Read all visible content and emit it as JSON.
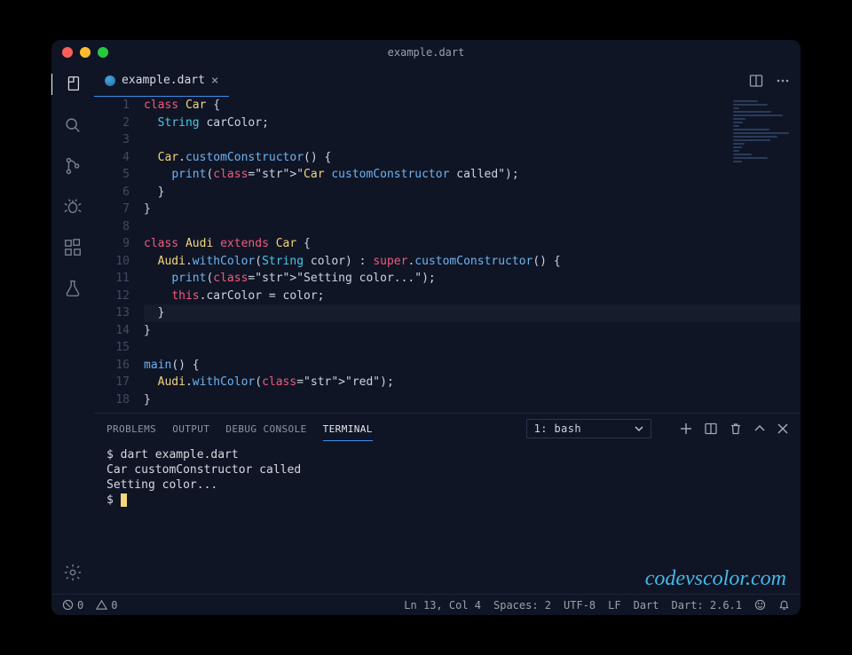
{
  "window": {
    "title": "example.dart"
  },
  "tab": {
    "filename": "example.dart"
  },
  "code": {
    "lines": [
      "class Car {",
      "  String carColor;",
      "",
      "  Car.customConstructor() {",
      "    print(\"Car customConstructor called\");",
      "  }",
      "}",
      "",
      "class Audi extends Car {",
      "  Audi.withColor(String color) : super.customConstructor() {",
      "    print(\"Setting color...\");",
      "    this.carColor = color;",
      "  }",
      "}",
      "",
      "main() {",
      "  Audi.withColor(\"red\");",
      "}"
    ],
    "line_count": 18,
    "highlight_line": 13
  },
  "panel": {
    "tabs": {
      "problems": "PROBLEMS",
      "output": "OUTPUT",
      "debug": "DEBUG CONSOLE",
      "terminal": "TERMINAL"
    },
    "terminal_selector": "1: bash",
    "terminal_output": "$ dart example.dart\nCar customConstructor called\nSetting color...\n$ "
  },
  "statusbar": {
    "errors": "0",
    "warnings": "0",
    "cursor": "Ln 13, Col 4",
    "spaces": "Spaces: 2",
    "encoding": "UTF-8",
    "eol": "LF",
    "lang": "Dart",
    "sdk": "Dart: 2.6.1"
  },
  "watermark": "codevscolor.com"
}
